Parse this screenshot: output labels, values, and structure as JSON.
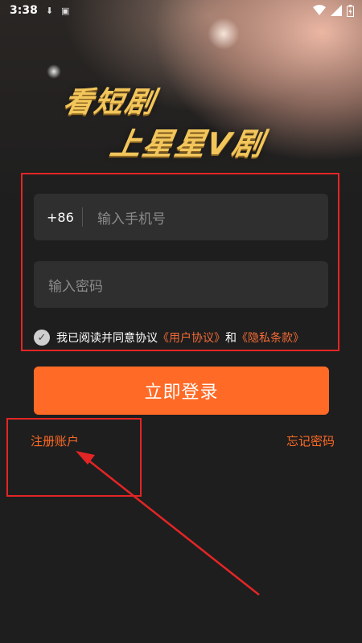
{
  "status_bar": {
    "time": "3:38",
    "icons_left": [
      "download-icon",
      "a-icon"
    ],
    "icons_right": [
      "wifi-icon",
      "signal-icon",
      "battery-icon"
    ]
  },
  "hero": {
    "line1": "看短剧",
    "line2": "上星星V剧"
  },
  "form": {
    "phone_prefix": "+86",
    "phone_placeholder": "输入手机号",
    "password_placeholder": "输入密码",
    "agreement_text": "我已阅读并同意协议",
    "user_agreement": "《用户协议》",
    "and_text": "和",
    "privacy_policy": "《隐私条款》",
    "agreement_checked": true
  },
  "actions": {
    "login_label": "立即登录",
    "register_label": "注册账户",
    "forgot_label": "忘记密码"
  },
  "colors": {
    "accent": "#ff6a26",
    "annotation": "#e42525",
    "background": "#1e1e1e"
  }
}
